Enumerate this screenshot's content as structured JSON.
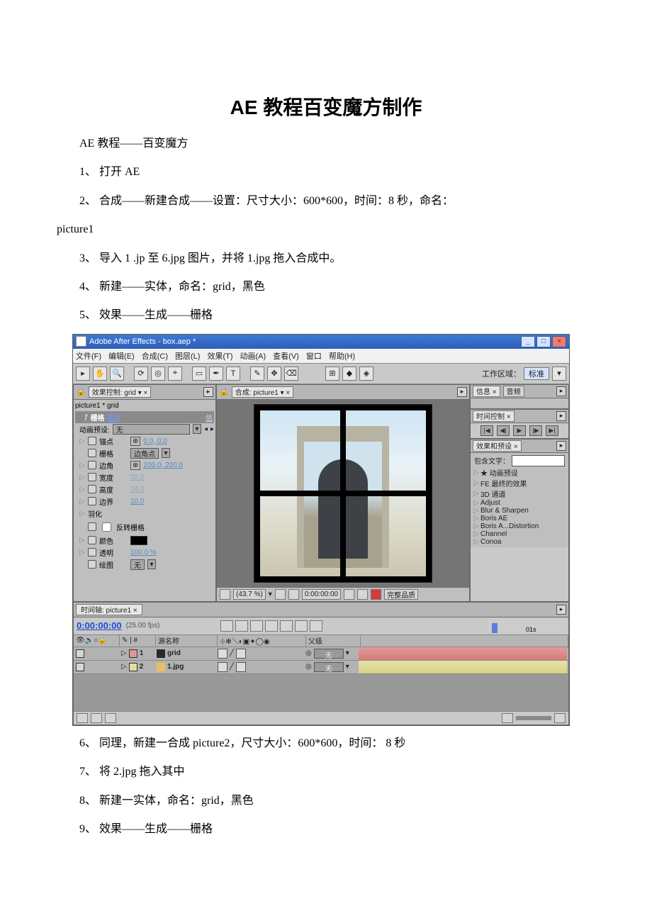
{
  "doc": {
    "title": "AE 教程百变魔方制作",
    "subtitle": "AE 教程——百变魔方",
    "steps": {
      "s1": "1、 打开 AE",
      "s2a": "2、 合成——新建合成——设置：尺寸大小：600*600，时间：8 秒，命名：",
      "s2b": "picture1",
      "s3": "3、 导入 1 .jp 至 6.jpg 图片，并将 1.jpg 拖入合成中。",
      "s4": "4、 新建——实体，命名：grid，黑色",
      "s5": "5、 效果——生成——栅格",
      "s6": "6、 同理，新建一合成 picture2，尺寸大小：600*600，时间： 8 秒",
      "s7": "7、 将 2.jpg 拖入其中",
      "s8": "8、 新建一实体，命名：grid，黑色",
      "s9": "9、 效果——生成——栅格"
    }
  },
  "ae": {
    "title": "Adobe After Effects - box.aep *",
    "menus": [
      "文件(F)",
      "编辑(E)",
      "合成(C)",
      "图层(L)",
      "效果(T)",
      "动画(A)",
      "查看(V)",
      "窗口",
      "帮助(H)"
    ],
    "workspace_label": "工作区域：",
    "workspace_value": "标准",
    "ec": {
      "tab": "效果控制: grid ▾ ×",
      "crumb": "picture1 * grid",
      "effect_name": "栅格",
      "reset": "重置",
      "about": "信",
      "preset_label": "动画预设:",
      "preset_value": "无",
      "rows": [
        {
          "label": "锚点",
          "value": "0.0, 0.0",
          "type": "link",
          "icon": "target"
        },
        {
          "label": "栅格",
          "value": "边角点",
          "type": "sel"
        },
        {
          "label": "边角",
          "value": "200.0, 200.0",
          "type": "link",
          "icon": "target"
        },
        {
          "label": "宽度",
          "value": "32.0",
          "type": "dim"
        },
        {
          "label": "高度",
          "value": "24.0",
          "type": "dim"
        },
        {
          "label": "边界",
          "value": "10.0",
          "type": "link"
        },
        {
          "label": "羽化",
          "value": "",
          "type": "group"
        },
        {
          "label": "反转栅格",
          "value": "",
          "type": "check"
        },
        {
          "label": "颜色",
          "value": "",
          "type": "color"
        },
        {
          "label": "透明",
          "value": "100.0 %",
          "type": "link"
        },
        {
          "label": "绘图",
          "value": "无",
          "type": "sel"
        }
      ]
    },
    "viewer": {
      "tab": "合成: picture1 ▾ ×",
      "zoom": "(43.7 %)",
      "time": "0:00:00:00",
      "quality": "完整品质"
    },
    "info_tab": "信息 ×",
    "audio_tab": "音频",
    "timectrl_tab": "时间控制 ×",
    "timectrl_btns": [
      "|◀",
      "◀|",
      "▶",
      "|▶",
      "▶|"
    ],
    "presets": {
      "tab": "效果和预设 ×",
      "contains": "包含文字：",
      "items": [
        "★ 动画预设",
        "FE 最终的效果",
        "3D 通道",
        "Adjust",
        "Blur & Sharpen",
        "Boris AE",
        "Boris A...Distortion",
        "Channel",
        "Conoa"
      ]
    },
    "timeline": {
      "tab": "时间轴: picture1 ×",
      "timecode": "0:00:00:00",
      "fps": "(25.00 fps)",
      "source_col": "源名称",
      "parent_col": "父级",
      "parent_none": "无",
      "ruler": "01s",
      "layers": [
        {
          "n": "1",
          "name": "grid",
          "color": "#2a2a2a",
          "track": "a"
        },
        {
          "n": "2",
          "name": "1.jpg",
          "color": "#e8c060",
          "track": "b"
        }
      ]
    }
  }
}
